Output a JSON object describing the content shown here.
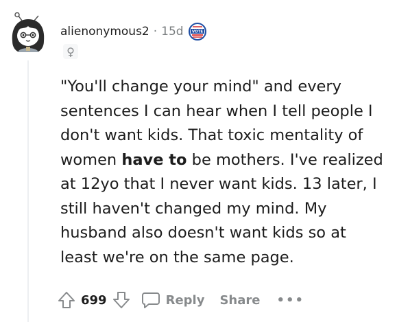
{
  "comment": {
    "author": "alienonymous2",
    "separator": "·",
    "time_ago": "15d",
    "award_icon": "vote-badge-icon",
    "flair_symbol": "♀",
    "body_lines": {
      "l1": "\"You'll change your mind\" and every",
      "l2": "sentences I can hear when I tell people I",
      "l3": "don't want kids. That toxic mentality of",
      "l4_pre": "women ",
      "l4_bold": "have to",
      "l4_post": " be mothers. I've realized",
      "l5": "at 12yo that I never want kids. 13 later, I",
      "l6": "still haven't changed my mind. My",
      "l7": "husband also doesn't want kids so at",
      "l8": "least we're on the same page."
    }
  },
  "actions": {
    "upvote_icon": "arrow-up-icon",
    "score": "699",
    "downvote_icon": "arrow-down-icon",
    "reply_icon": "chat-bubble-icon",
    "reply_label": "Reply",
    "share_label": "Share",
    "more_label": "•••"
  },
  "colors": {
    "text": "#1c1c1c",
    "meta": "#787c7e",
    "action": "#878a8c",
    "badge_blue": "#1f4ea3",
    "badge_red": "#d93a3a"
  }
}
